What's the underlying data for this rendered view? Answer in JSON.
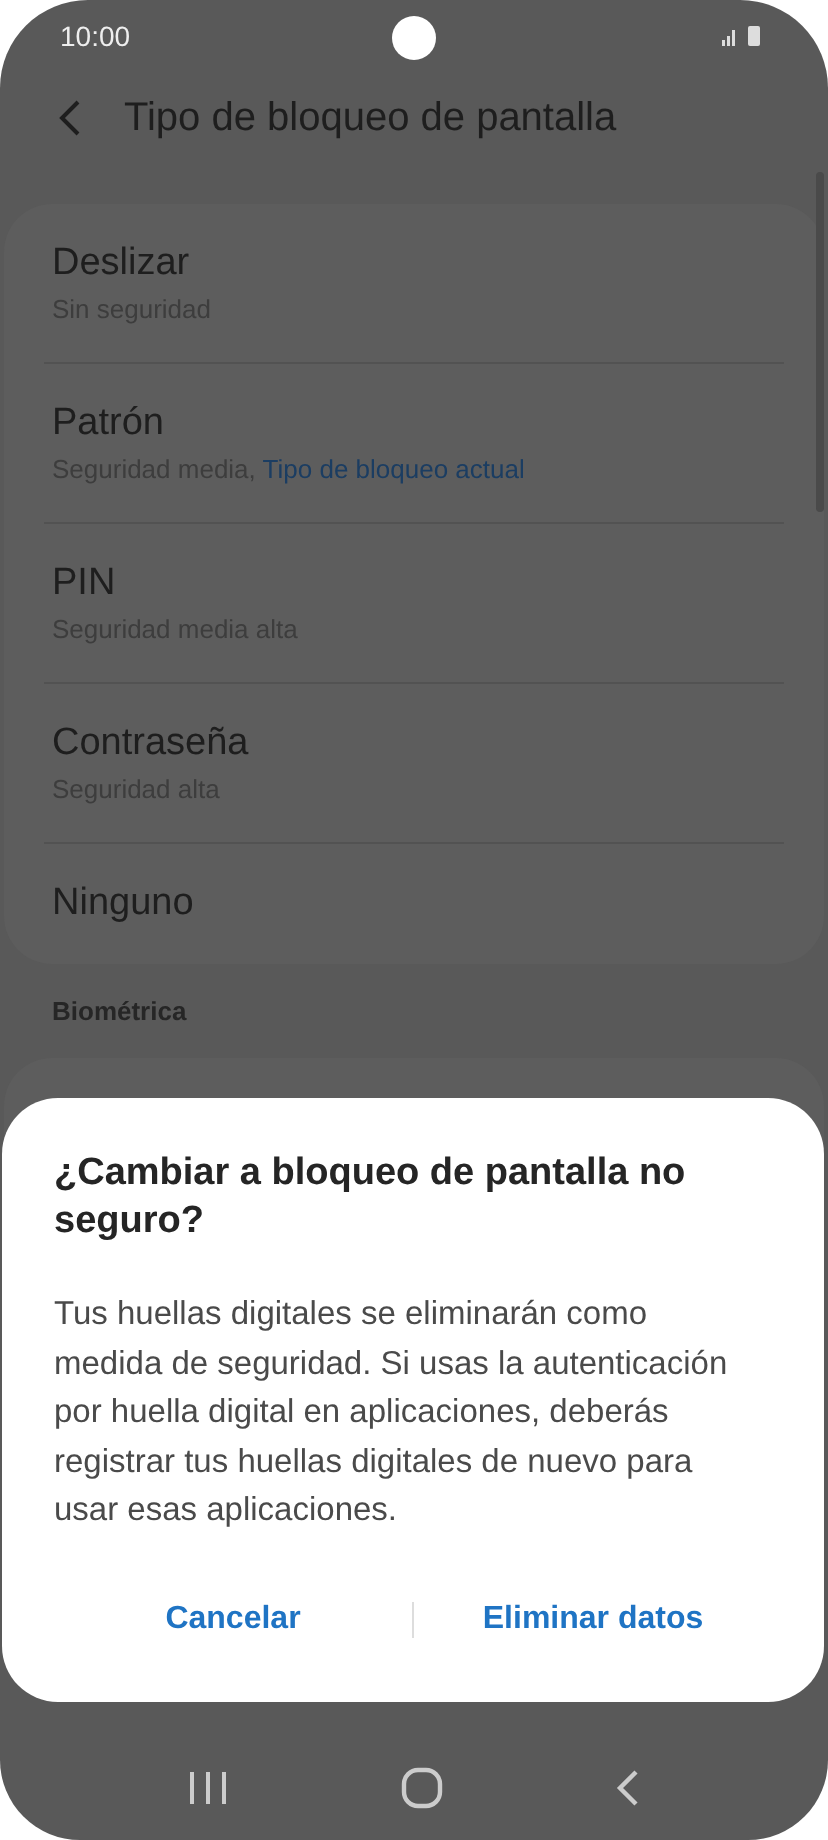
{
  "status_bar": {
    "time": "10:00"
  },
  "header": {
    "title": "Tipo de bloqueo de pantalla"
  },
  "lock_types": [
    {
      "title": "Deslizar",
      "subtitle": "Sin seguridad"
    },
    {
      "title": "Patrón",
      "subtitle": "Seguridad media,",
      "current": "Tipo de bloqueo actual"
    },
    {
      "title": "PIN",
      "subtitle": "Seguridad media alta"
    },
    {
      "title": "Contraseña",
      "subtitle": "Seguridad alta"
    },
    {
      "title": "Ninguno"
    }
  ],
  "biometrics": {
    "heading": "Biométrica"
  },
  "dialog": {
    "title": "¿Cambiar a bloqueo de pantalla no seguro?",
    "message": "Tus huellas digitales se eliminarán como medida de seguridad. Si usas la autenticación por huella digital en aplicaciones, deberás registrar tus huellas digitales de nuevo para usar esas aplicaciones.",
    "buttons": [
      "Cancelar",
      "Eliminar datos"
    ]
  }
}
